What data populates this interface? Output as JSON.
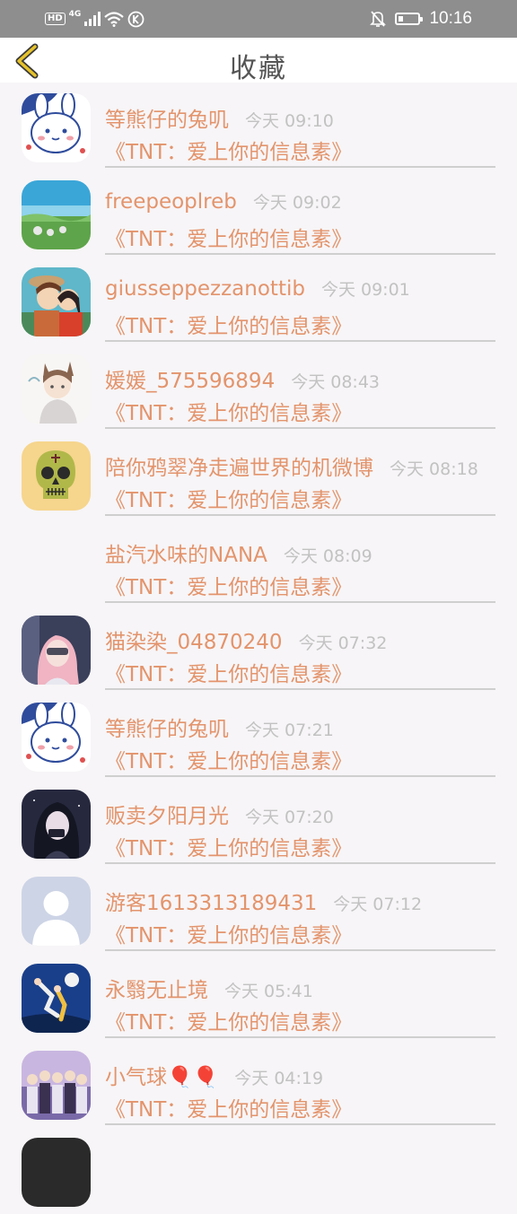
{
  "status_bar": {
    "hd": "HD",
    "network": "4G",
    "time": "10:16",
    "battery_level": 0.2
  },
  "header": {
    "title": "收藏"
  },
  "items": [
    {
      "name": "等熊仔的兔叽",
      "time": "今天 09:10",
      "song": "《TNT：爱上你的信息素》",
      "avatar": "bunny"
    },
    {
      "name": "freepeoplreb",
      "time": "今天 09:02",
      "song": "《TNT：爱上你的信息素》",
      "avatar": "lake"
    },
    {
      "name": "giusseppezzanottib",
      "time": "今天 09:01",
      "song": "《TNT：爱上你的信息素》",
      "avatar": "anime-couple"
    },
    {
      "name": "媛媛_575596894",
      "time": "今天 08:43",
      "song": "《TNT：爱上你的信息素》",
      "avatar": "anime-catboy"
    },
    {
      "name": "陪你鸦翠净走遍世界的机微博",
      "time": "今天 08:18",
      "song": "《TNT：爱上你的信息素》",
      "avatar": "skull"
    },
    {
      "name": "盐汽水味的NANA",
      "time": "今天 08:09",
      "song": "《TNT：爱上你的信息素》",
      "avatar": "none"
    },
    {
      "name": "猫染染_04870240",
      "time": "今天 07:32",
      "song": "《TNT：爱上你的信息素》",
      "avatar": "girl-pink"
    },
    {
      "name": "等熊仔的兔叽",
      "time": "今天 07:21",
      "song": "《TNT：爱上你的信息素》",
      "avatar": "bunny"
    },
    {
      "name": "贩卖夕阳月光",
      "time": "今天 07:20",
      "song": "《TNT：爱上你的信息素》",
      "avatar": "girl-dark"
    },
    {
      "name": "游客1613313189431",
      "time": "今天 07:12",
      "song": "《TNT：爱上你的信息素》",
      "avatar": "default"
    },
    {
      "name": "永翳无止境",
      "time": "今天 05:41",
      "song": "《TNT：爱上你的信息素》",
      "avatar": "figures"
    },
    {
      "name": "小气球🎈🎈",
      "time": "今天 04:19",
      "song": "《TNT：爱上你的信息素》",
      "avatar": "group"
    }
  ]
}
